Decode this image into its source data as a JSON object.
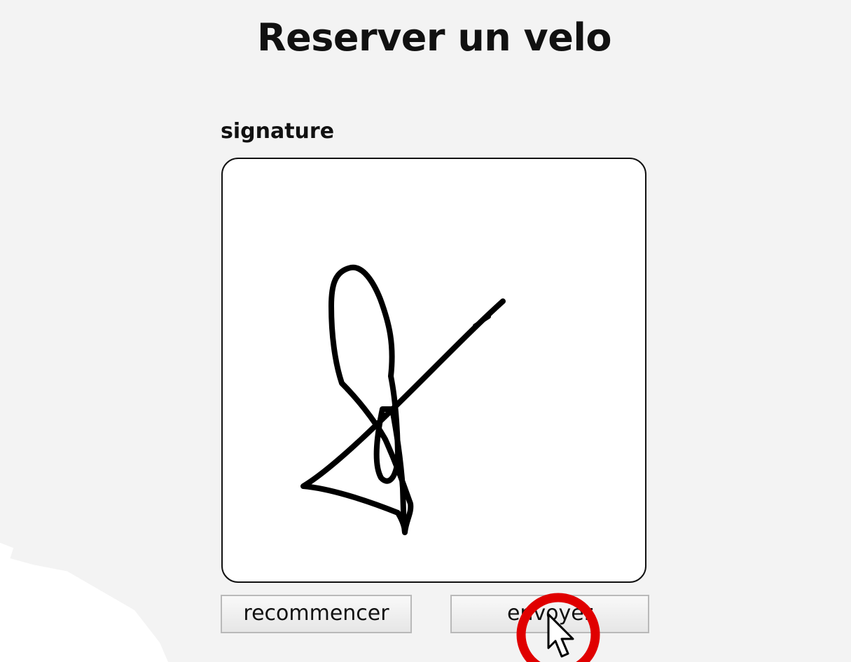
{
  "page": {
    "title": "Reserver un velo"
  },
  "form": {
    "signature_label": "signature",
    "reset_label": "recommencer",
    "submit_label": "envoyer"
  },
  "icons": {
    "cursor": "arrow-cursor-icon",
    "click_indicator": "red-circle-click-indicator"
  },
  "colors": {
    "background": "#f3f3f3",
    "ink": "#000000",
    "click_indicator": "#e00000"
  }
}
